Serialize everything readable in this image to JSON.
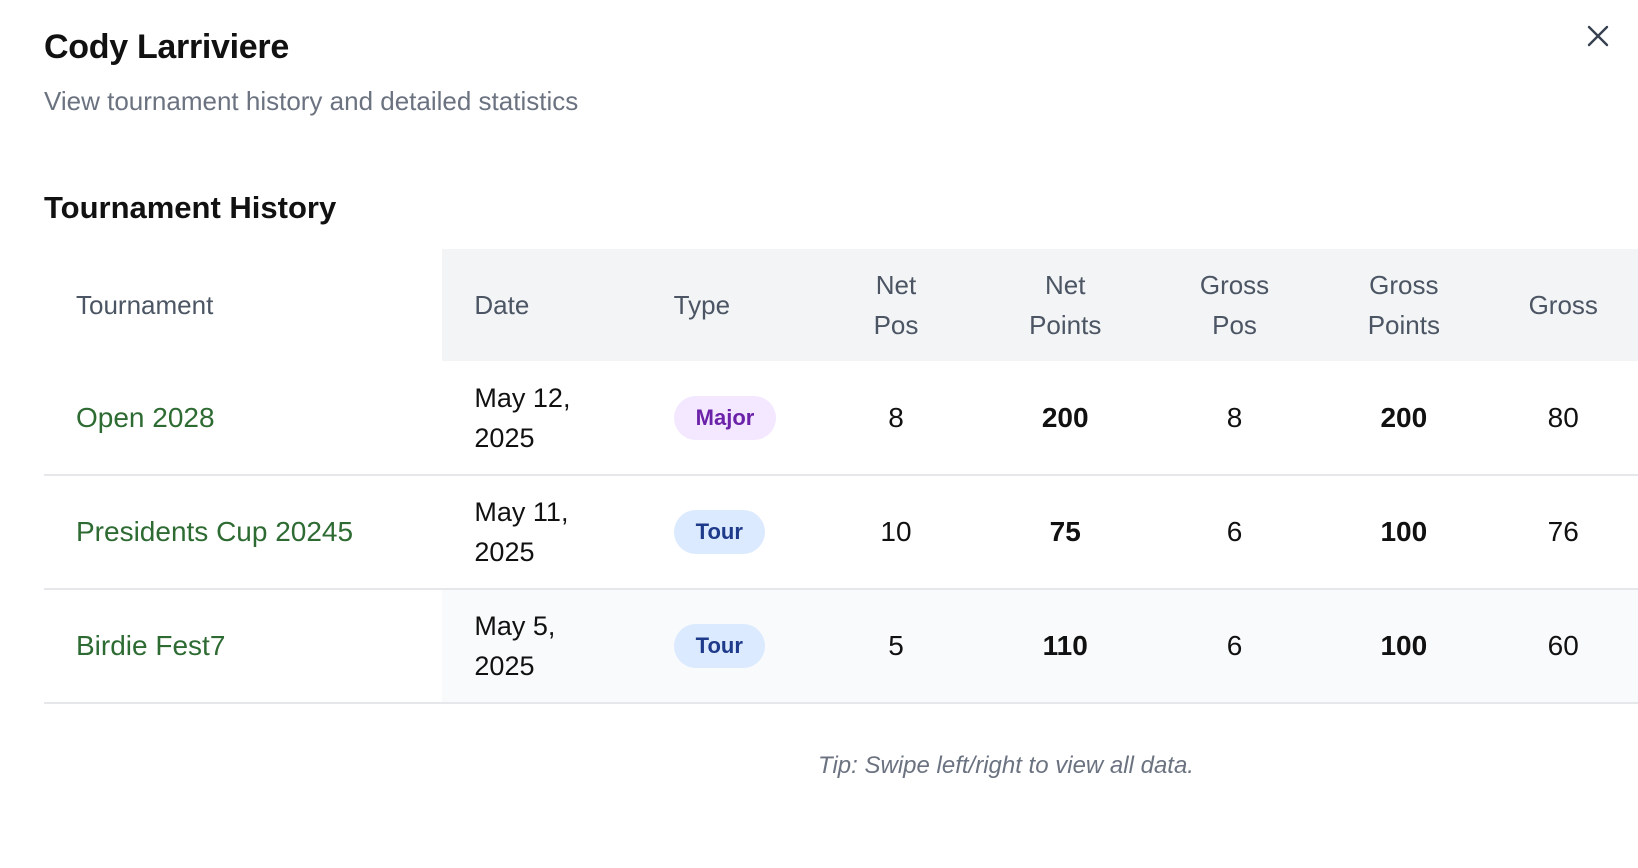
{
  "header": {
    "title": "Cody Larriviere",
    "subtitle": "View tournament history and detailed statistics",
    "close_icon": "close-icon"
  },
  "section": {
    "title": "Tournament History"
  },
  "table": {
    "columns": {
      "tournament": "Tournament",
      "date": "Date",
      "type": "Type",
      "net_pos_1": "Net",
      "net_pos_2": "Pos",
      "net_points_1": "Net",
      "net_points_2": "Points",
      "gross_pos_1": "Gross",
      "gross_pos_2": "Pos",
      "gross_points_1": "Gross",
      "gross_points_2": "Points",
      "gross": "Gross"
    },
    "rows": [
      {
        "tournament": "Open 2028",
        "date_line1": "May 12,",
        "date_line2": "2025",
        "type": "Major",
        "net_pos": "8",
        "net_points": "200",
        "gross_pos": "8",
        "gross_points": "200",
        "gross": "80"
      },
      {
        "tournament": "Presidents Cup 20245",
        "date_line1": "May 11,",
        "date_line2": "2025",
        "type": "Tour",
        "net_pos": "10",
        "net_points": "75",
        "gross_pos": "6",
        "gross_points": "100",
        "gross": "76"
      },
      {
        "tournament": "Birdie Fest7",
        "date_line1": "May 5,",
        "date_line2": "2025",
        "type": "Tour",
        "net_pos": "5",
        "net_points": "110",
        "gross_pos": "6",
        "gross_points": "100",
        "gross": "60"
      }
    ]
  },
  "footer": {
    "tip": "Tip: Swipe left/right to view all data."
  },
  "colors": {
    "tournament_link": "#2e6b33",
    "major_badge_bg": "#f3e8ff",
    "major_badge_text": "#6b21a8",
    "tour_badge_bg": "#dbeafe",
    "tour_badge_text": "#1e3a8a",
    "header_bg": "#f3f4f6"
  }
}
